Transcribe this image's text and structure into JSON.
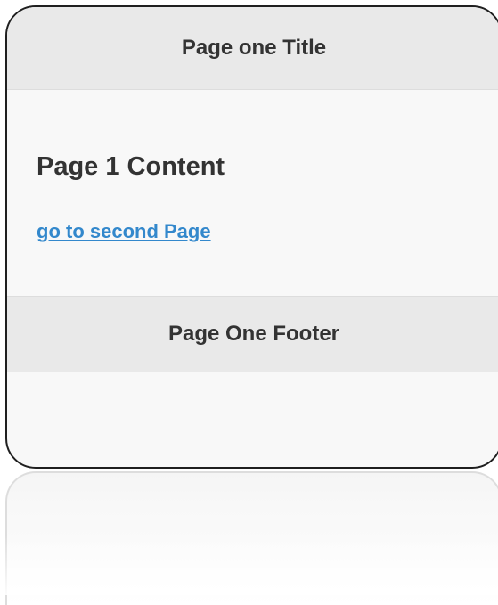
{
  "header": {
    "title": "Page one Title"
  },
  "content": {
    "heading": "Page 1 Content",
    "link_label": "go to second Page"
  },
  "footer": {
    "title": "Page One Footer"
  },
  "colors": {
    "bar_background": "#e9e9e9",
    "page_background": "#f8f8f8",
    "link": "#3388cc",
    "text": "#333333",
    "device_border": "#1f1f1f"
  }
}
